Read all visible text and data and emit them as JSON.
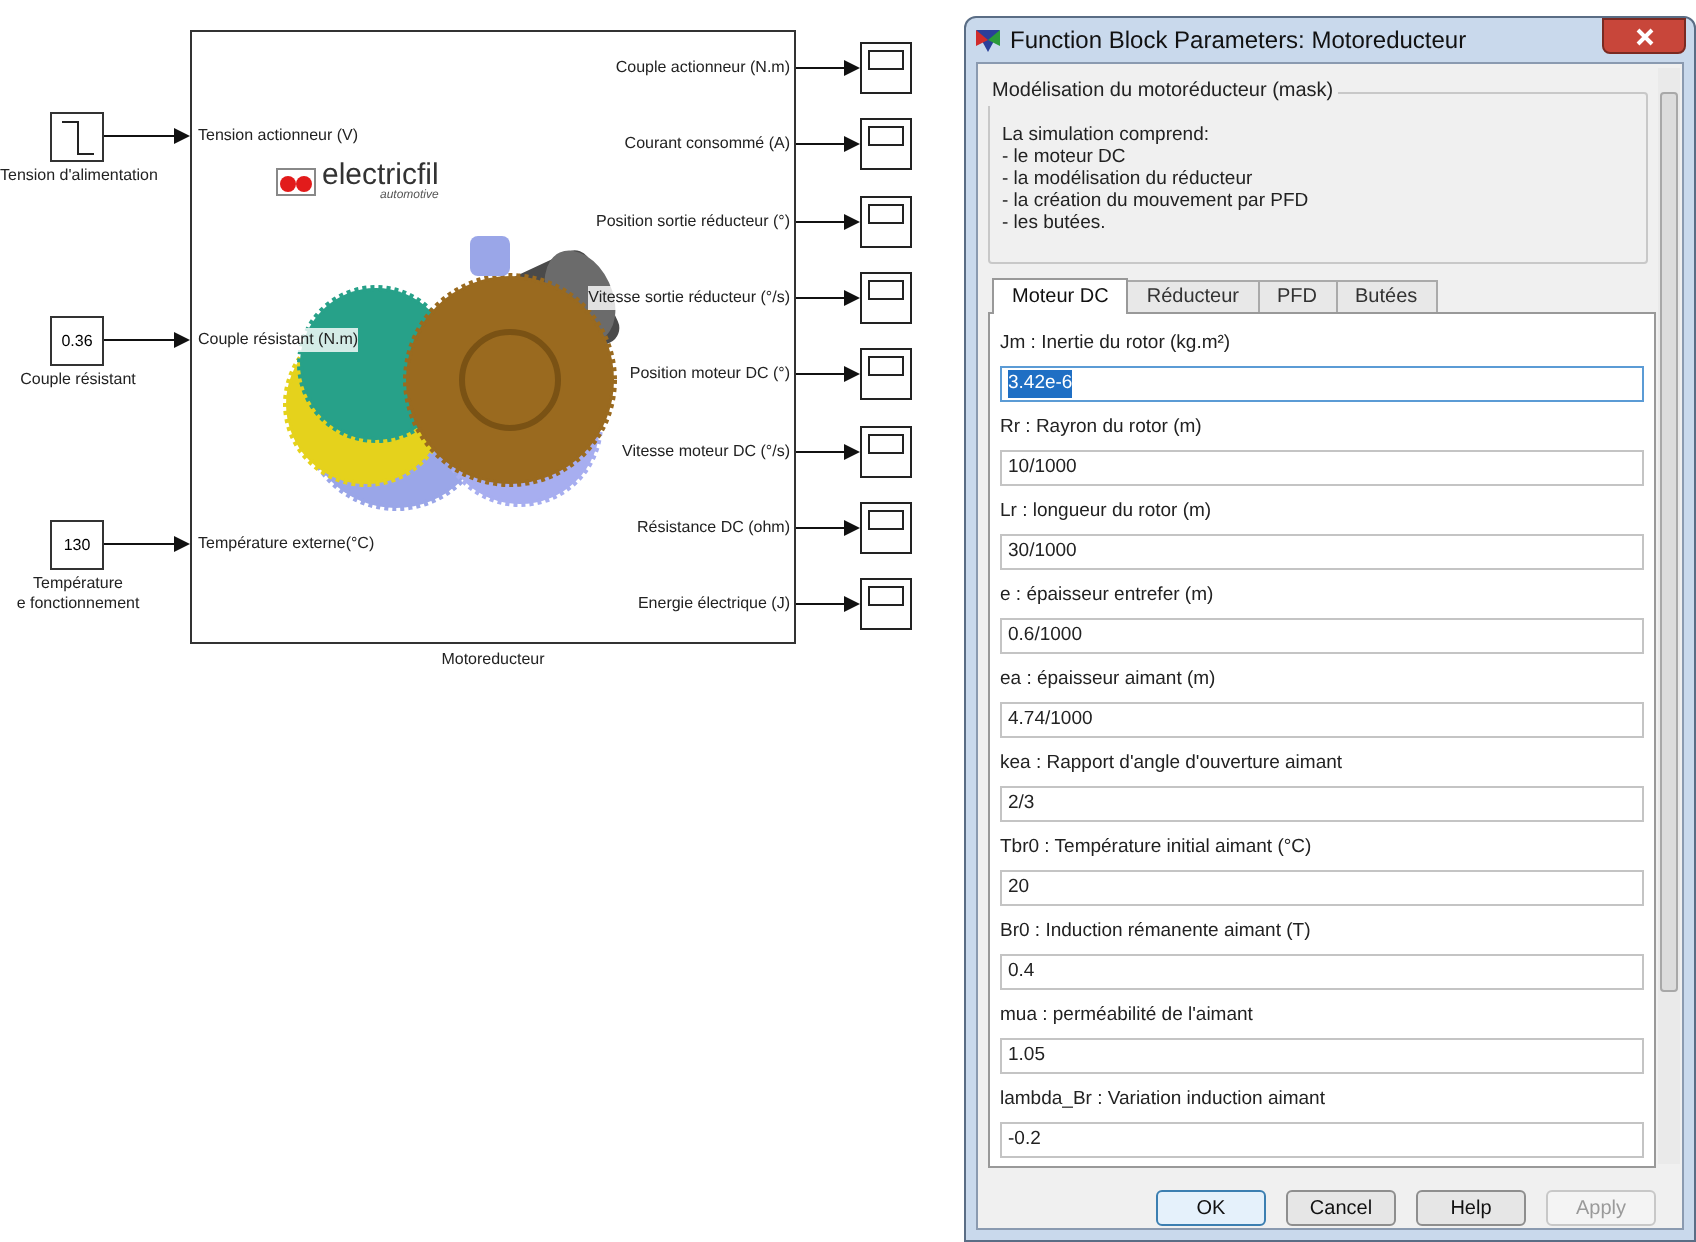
{
  "diagram": {
    "block_name": "Motoreducteur",
    "logo": {
      "name": "electricfil",
      "tagline": "automotive"
    },
    "inputs": [
      {
        "kind": "step",
        "port": "Tension actionneur (V)",
        "caption": "Tension d'alimentation"
      },
      {
        "kind": "constant",
        "value": "0.36",
        "port": "Couple résistant (N.m)",
        "caption": "Couple résistant"
      },
      {
        "kind": "constant",
        "value": "130",
        "port": "Température externe(°C)",
        "caption": "Température\ne fonctionnement"
      }
    ],
    "outputs": [
      "Couple actionneur (N.m)",
      "Courant consommé (A)",
      "Position sortie réducteur (°)",
      "Vitesse sortie réducteur (°/s)",
      "Position moteur DC (°)",
      "Vitesse moteur DC (°/s)",
      "Résistance DC (ohm)",
      "Energie électrique (J)"
    ]
  },
  "dialog": {
    "title": "Function Block Parameters: Motoreducteur",
    "group_title": "Modélisation du motoréducteur (mask)",
    "description": [
      "La simulation comprend:",
      "- le moteur DC",
      "- la modélisation du réducteur",
      "- la création du mouvement par PFD",
      "- les butées."
    ],
    "tabs": [
      {
        "label": "Moteur DC",
        "selected": true
      },
      {
        "label": "Réducteur",
        "selected": false
      },
      {
        "label": "PFD",
        "selected": false
      },
      {
        "label": "Butées",
        "selected": false
      }
    ],
    "parameters": [
      {
        "label": "Jm : Inertie du rotor (kg.m²)",
        "value": "3.42e-6",
        "focused": true
      },
      {
        "label": "Rr : Rayron du rotor (m)",
        "value": "10/1000",
        "focused": false
      },
      {
        "label": "Lr : longueur du rotor (m)",
        "value": "30/1000",
        "focused": false
      },
      {
        "label": "e : épaisseur entrefer (m)",
        "value": "0.6/1000",
        "focused": false
      },
      {
        "label": "ea : épaisseur aimant (m)",
        "value": "4.74/1000",
        "focused": false
      },
      {
        "label": "kea : Rapport d'angle d'ouverture aimant",
        "value": "2/3",
        "focused": false
      },
      {
        "label": "Tbr0 : Température initial aimant (°C)",
        "value": "20",
        "focused": false
      },
      {
        "label": "Br0 : Induction rémanente aimant (T)",
        "value": "0.4",
        "focused": false
      },
      {
        "label": "mua : perméabilité de l'aimant",
        "value": "1.05",
        "focused": false
      },
      {
        "label": "lambda_Br : Variation induction aimant",
        "value": "-0.2",
        "focused": false
      }
    ],
    "buttons": [
      {
        "label": "OK",
        "default": true,
        "disabled": false
      },
      {
        "label": "Cancel",
        "default": false,
        "disabled": false
      },
      {
        "label": "Help",
        "default": false,
        "disabled": false
      },
      {
        "label": "Apply",
        "default": false,
        "disabled": true
      }
    ]
  }
}
